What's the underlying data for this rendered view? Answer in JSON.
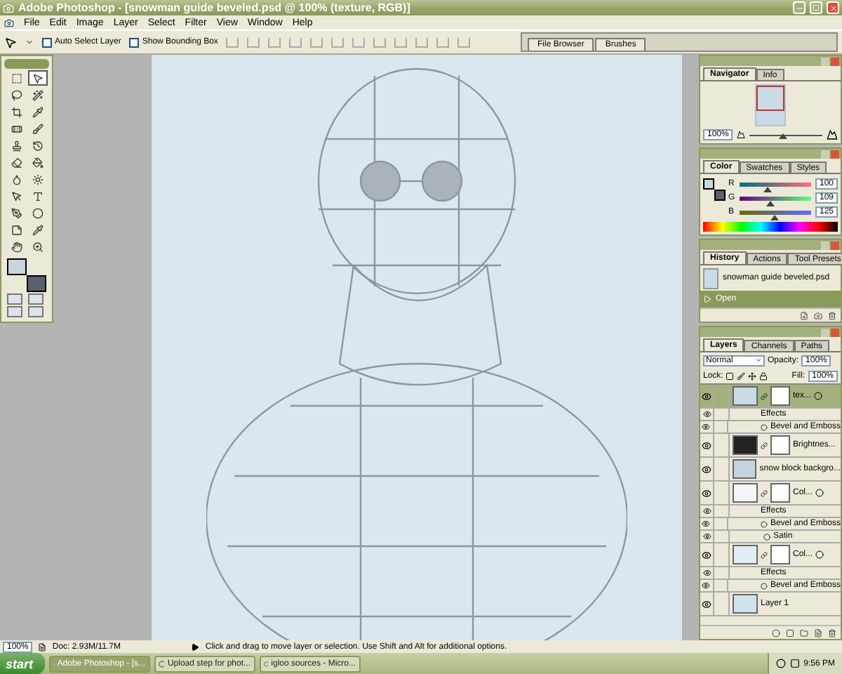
{
  "window": {
    "title": "Adobe Photoshop - [snowman guide beveled.psd @ 100% (texture, RGB)]"
  },
  "menu": [
    "File",
    "Edit",
    "Image",
    "Layer",
    "Select",
    "Filter",
    "View",
    "Window",
    "Help"
  ],
  "options_bar": {
    "checkboxes": [
      {
        "label": "Auto Select Layer",
        "checked": false
      },
      {
        "label": "Show Bounding Box",
        "checked": false
      }
    ],
    "palette_well": [
      {
        "label": "File Browser"
      },
      {
        "label": "Brushes"
      }
    ]
  },
  "toolbox": {
    "tools": [
      {
        "selected": false
      },
      {
        "selected": true
      },
      {
        "selected": false
      },
      {
        "selected": false
      },
      {
        "selected": false
      },
      {
        "selected": false
      },
      {
        "selected": false
      },
      {
        "selected": false
      },
      {
        "selected": false
      },
      {
        "selected": false
      },
      {
        "selected": false
      },
      {
        "selected": false
      },
      {
        "selected": false
      },
      {
        "selected": false
      },
      {
        "selected": false
      },
      {
        "selected": false
      },
      {
        "selected": false
      },
      {
        "selected": false
      },
      {
        "selected": false
      },
      {
        "selected": false
      },
      {
        "selected": false
      },
      {
        "selected": false
      }
    ],
    "foreground": {
      "color": "#c8d5dd"
    },
    "background": {
      "color": "#5a6070"
    }
  },
  "navigator": {
    "tabs": [
      {
        "label": "Navigator",
        "selected": true
      },
      {
        "label": "Info",
        "selected": false
      }
    ],
    "zoom": "100%",
    "level": 0.45
  },
  "color": {
    "tabs": [
      {
        "label": "Color",
        "selected": true
      },
      {
        "label": "Swatches",
        "selected": false
      },
      {
        "label": "Styles",
        "selected": false
      }
    ],
    "channels": [
      {
        "name": "R",
        "value": "100",
        "level": 0.39
      },
      {
        "name": "G",
        "value": "109",
        "level": 0.43
      },
      {
        "name": "B",
        "value": "125",
        "level": 0.49
      }
    ]
  },
  "history": {
    "tabs": [
      {
        "label": "History",
        "selected": true
      },
      {
        "label": "Actions",
        "selected": false
      },
      {
        "label": "Tool Presets",
        "selected": false
      }
    ],
    "items": [
      {
        "kind": "snapshot",
        "label": "snowman guide beveled.psd",
        "selected": false
      },
      {
        "kind": "step",
        "label": "Open",
        "selected": true
      }
    ]
  },
  "layers": {
    "tabs": [
      {
        "label": "Layers",
        "selected": true
      },
      {
        "label": "Channels",
        "selected": false
      },
      {
        "label": "Paths",
        "selected": false
      }
    ],
    "blend_mode": "Normal",
    "opacity_label": "Opacity:",
    "opacity": "100%",
    "lock_label": "Lock:",
    "fill_label": "Fill:",
    "fill": "100%",
    "rows": [
      {
        "kind": "layer",
        "name": "tex...",
        "selected": true,
        "mask": true,
        "fx": true
      },
      {
        "kind": "effects",
        "name": "Effects"
      },
      {
        "kind": "effect",
        "name": "Bevel and Emboss"
      },
      {
        "kind": "layer",
        "name": "Brightnes...",
        "selected": false,
        "mask": true,
        "fx": false
      },
      {
        "kind": "layer",
        "name": "snow block backgro...",
        "selected": false,
        "mask": false,
        "fx": false
      },
      {
        "kind": "layer",
        "name": "Col...",
        "selected": false,
        "mask": true,
        "fx": true
      },
      {
        "kind": "effects",
        "name": "Effects"
      },
      {
        "kind": "effect",
        "name": "Bevel and Emboss"
      },
      {
        "kind": "effect",
        "name": "Satin"
      },
      {
        "kind": "layer",
        "name": "Col...",
        "selected": false,
        "mask": true,
        "fx": true
      },
      {
        "kind": "effects",
        "name": "Effects"
      },
      {
        "kind": "effect",
        "name": "Bevel and Emboss"
      },
      {
        "kind": "layer",
        "name": "Layer 1",
        "selected": false,
        "mask": false,
        "fx": false
      }
    ]
  },
  "status_bar": {
    "zoom": "100%",
    "doc": "Doc: 2.93M/11.7M",
    "message": "Click and drag to move layer or selection.  Use Shift and Alt for additional options."
  },
  "taskbar": {
    "start": "start",
    "tasks": [
      {
        "label": "Adobe Photoshop - [s...",
        "selected": true
      },
      {
        "label": "Upload step for phot...",
        "selected": false
      },
      {
        "label": "igloo sources - Micro...",
        "selected": false
      }
    ],
    "clock": "9:56 PM"
  }
}
